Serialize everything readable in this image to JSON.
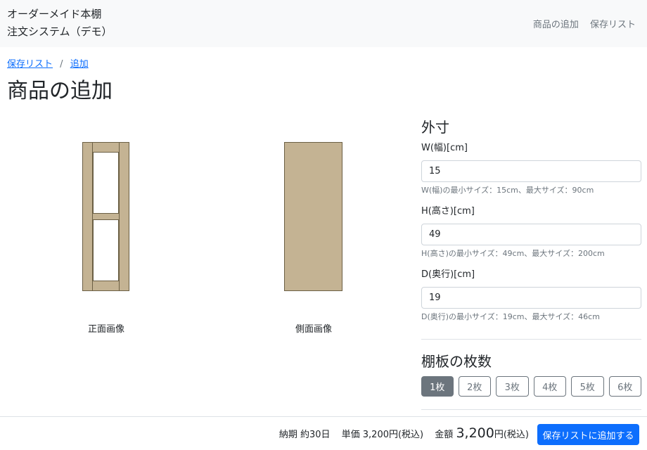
{
  "navbar": {
    "brand_line1": "オーダーメイド本棚",
    "brand_line2": "注文システム（デモ）",
    "links": [
      "商品の追加",
      "保存リスト"
    ]
  },
  "breadcrumb": {
    "items": [
      "保存リスト",
      "追加"
    ],
    "separator": "/"
  },
  "page_title": "商品の追加",
  "preview": {
    "front_caption": "正面画像",
    "side_caption": "側面画像",
    "wood_color": "#c4b393"
  },
  "dimensions": {
    "title": "外寸",
    "fields": [
      {
        "label": "W(幅)[cm]",
        "value": "15",
        "help": "W(幅)の最小サイズ：15cm、最大サイズ：90cm"
      },
      {
        "label": "H(高さ)[cm]",
        "value": "49",
        "help": "H(高さ)の最小サイズ：49cm、最大サイズ：200cm"
      },
      {
        "label": "D(奥行)[cm]",
        "value": "19",
        "help": "D(奥行)の最小サイズ：19cm、最大サイズ：46cm"
      }
    ]
  },
  "shelves": {
    "title": "棚板の枚数",
    "options": [
      "1枚",
      "2枚",
      "3枚",
      "4枚",
      "5枚",
      "6枚"
    ],
    "selected": "1枚"
  },
  "footer": {
    "delivery": "納期 約30日",
    "unit_price": "単価 3,200円(税込)",
    "amount_label": "金額",
    "amount_value": "3,200",
    "amount_suffix": "円(税込)",
    "add_button": "保存リストに追加する",
    "accent": "#0d6efd"
  }
}
